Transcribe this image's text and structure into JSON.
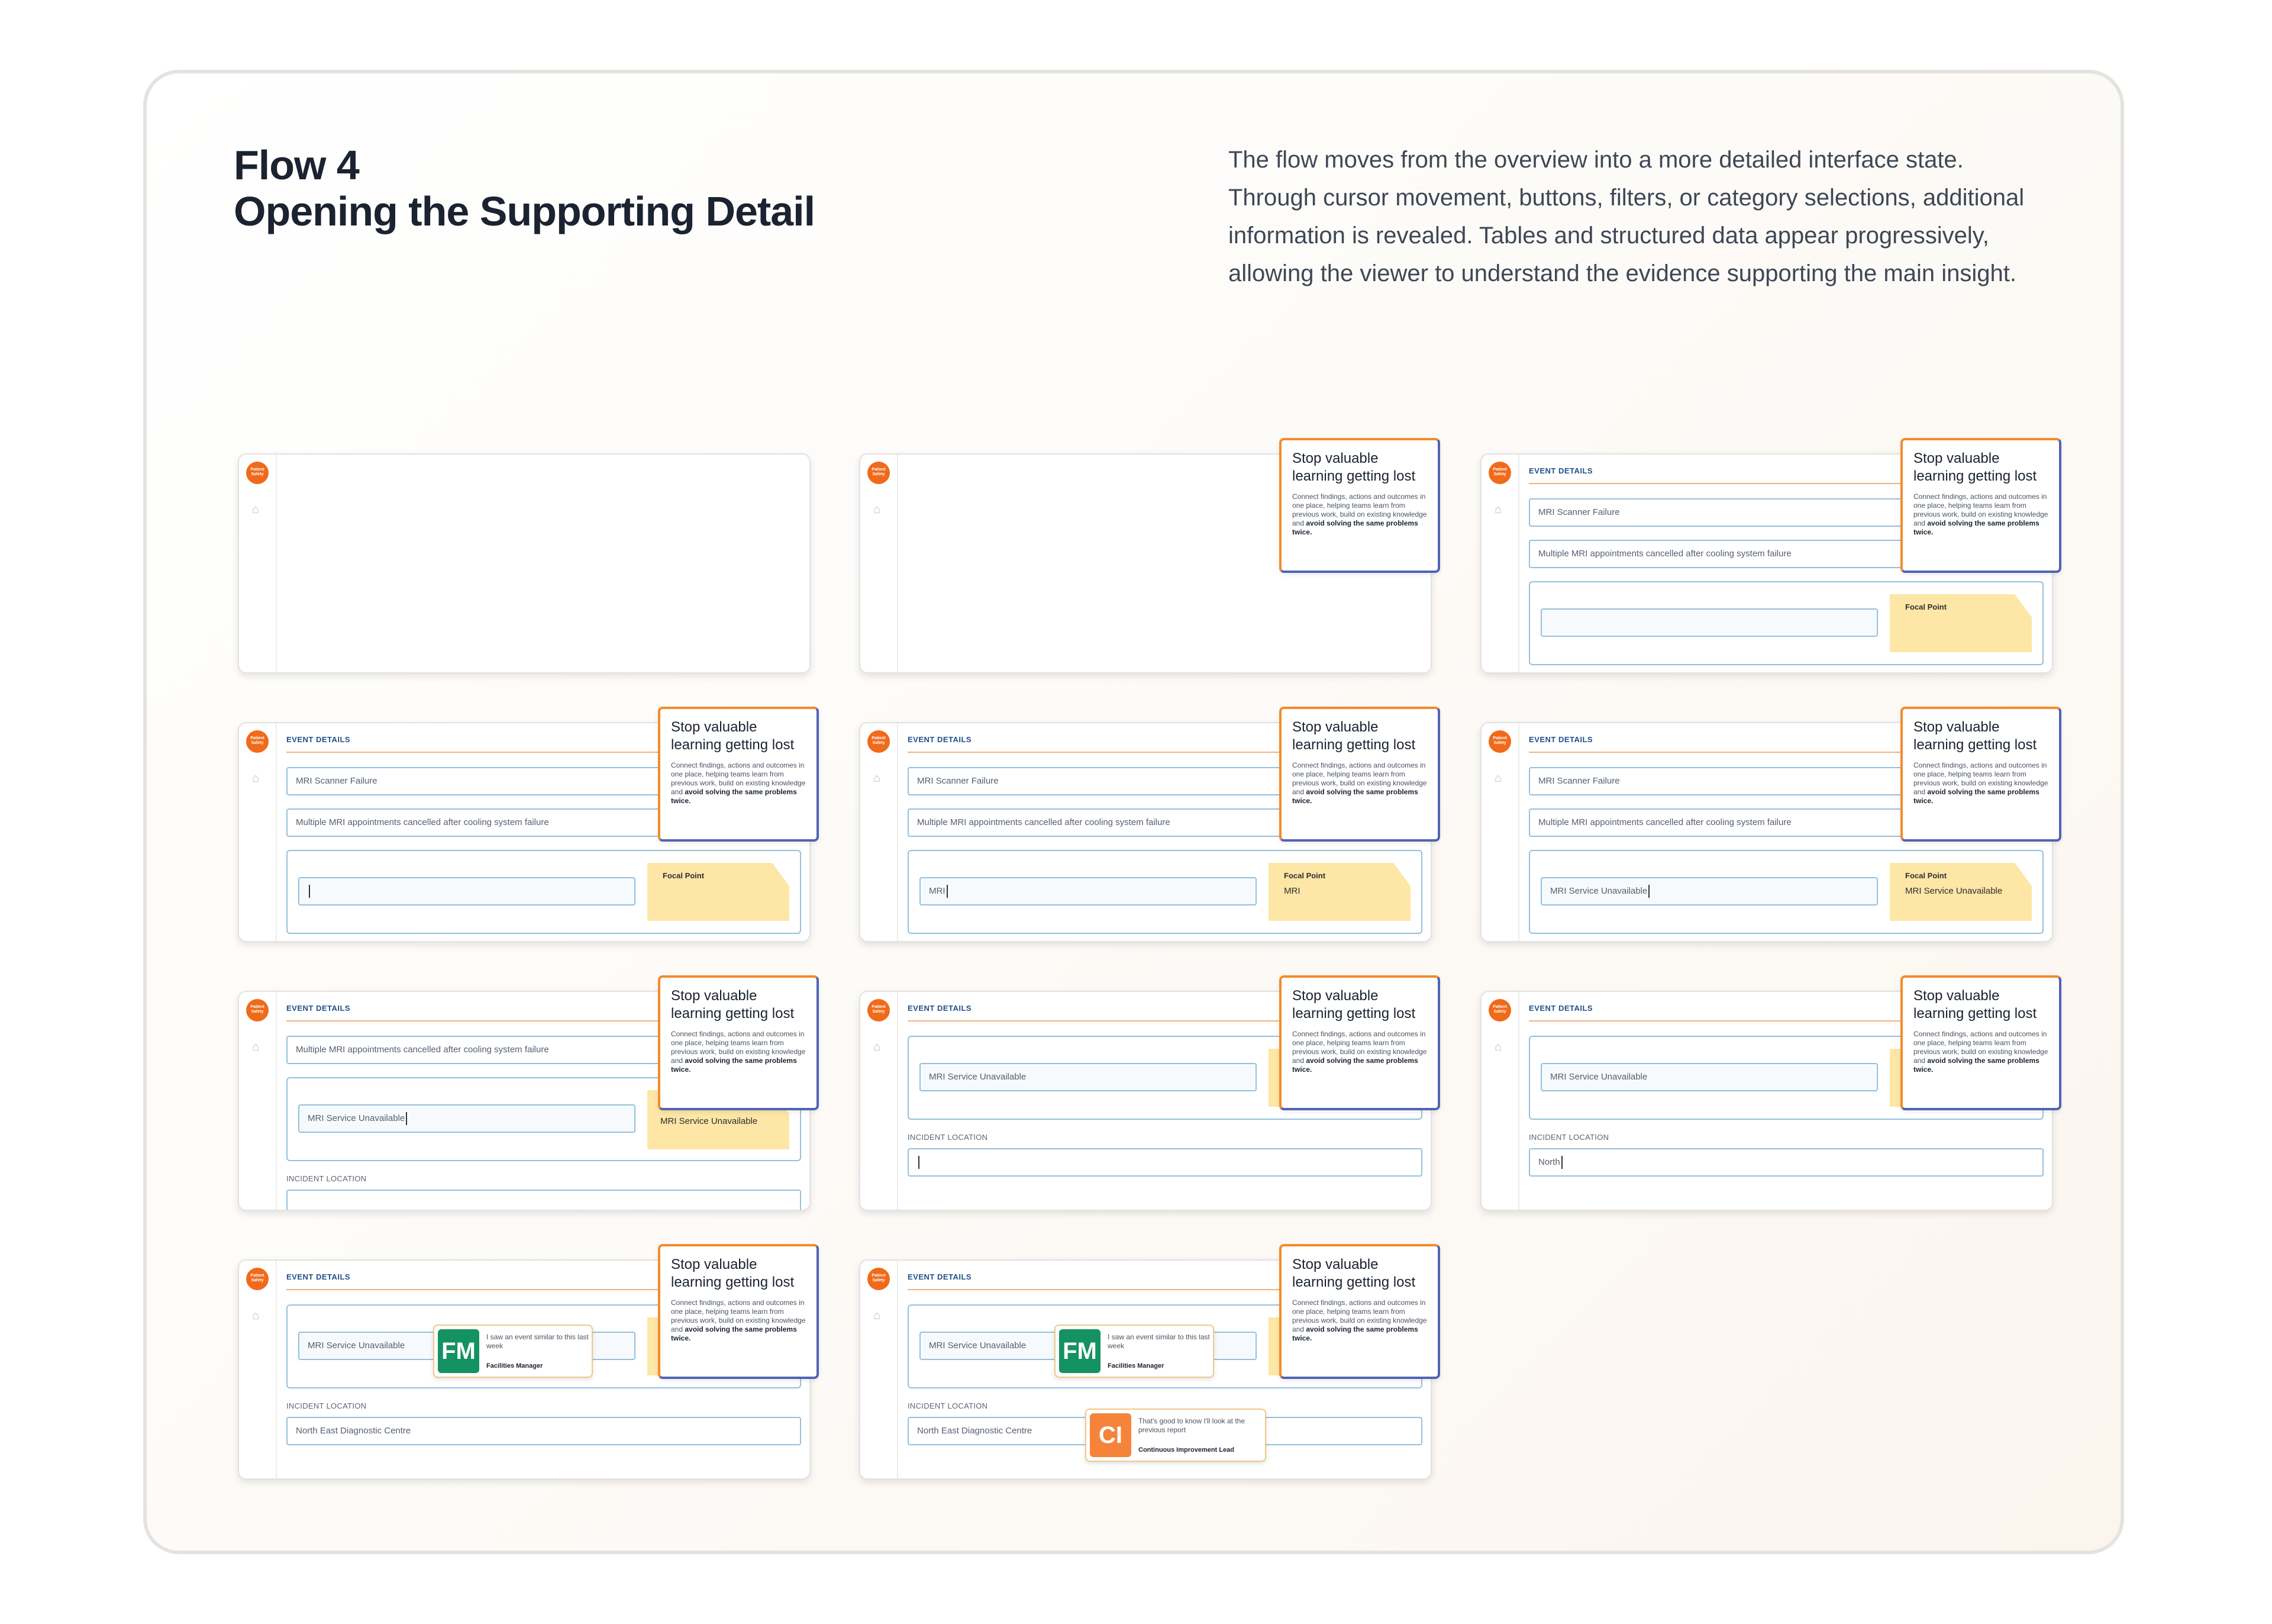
{
  "header": {
    "title_line1": "Flow 4",
    "title_line2": "Opening the Supporting Detail",
    "description": "The flow moves from the overview into a more detailed interface state. Through cursor movement, buttons, filters, or category selections, additional information is revealed. Tables and structured data appear progressively, allowing the viewer to understand the evidence supporting the main insight."
  },
  "app": {
    "logo_text": "Patient Safety",
    "section_title": "EVENT DETAILS",
    "incident_location_label": "INCIDENT LOCATION",
    "focal_point_label": "Focal Point"
  },
  "popup": {
    "title": "Stop valuable learning getting lost",
    "body_start": "Connect findings, actions and outcomes in one place, helping teams learn from previous work, build on existing knowledge and",
    "body_bold": "avoid solving the same problems twice."
  },
  "fields": {
    "event_title": "MRI Scanner Failure",
    "event_description": "Multiple MRI appointments cancelled after cooling system failure",
    "focal_partial": "MRI",
    "focal_value": "MRI Service Unavailable",
    "location_partial": "North",
    "location_value": "North East Diagnostic Centre"
  },
  "comments": {
    "fm": {
      "initials": "FM",
      "message": "I saw an event similar to this last week",
      "role": "Facilities Manager"
    },
    "ci": {
      "initials": "CI",
      "message": "That's good to know I'll look at the previous report",
      "role": "Continuous Improvement Lead"
    }
  },
  "icons": {
    "home": "home-icon",
    "logo": "logo-icon"
  },
  "colors": {
    "brand_orange": "#f06a1a",
    "focal_yellow": "#fde6a6",
    "field_border": "#94c0de",
    "popup_orange": "#f28c2c",
    "popup_blue": "#5063b5",
    "fm_green": "#149262",
    "ci_orange": "#f5843a"
  }
}
